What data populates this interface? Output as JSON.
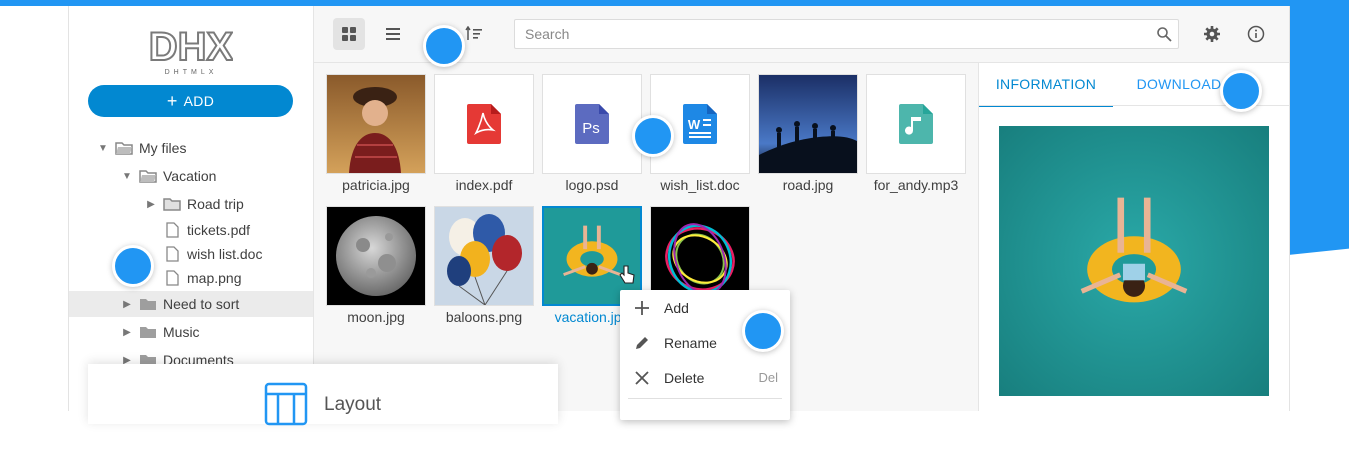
{
  "logo": {
    "main": "DHX",
    "sub": "DHTMLX"
  },
  "sidebar": {
    "add_label": "ADD",
    "tree": [
      {
        "label": "My files",
        "type": "folder-open",
        "expanded": true
      },
      {
        "label": "Vacation",
        "type": "folder-open",
        "expanded": true
      },
      {
        "label": "Road trip",
        "type": "folder",
        "expanded": false
      },
      {
        "label": "tickets.pdf",
        "type": "file"
      },
      {
        "label": "wish list.doc",
        "type": "file"
      },
      {
        "label": "map.png",
        "type": "file"
      },
      {
        "label": "Need to sort",
        "type": "folder-filled",
        "expanded": false,
        "selected": true
      },
      {
        "label": "Music",
        "type": "folder-filled",
        "expanded": false
      },
      {
        "label": "Documents",
        "type": "folder-filled",
        "expanded": false
      }
    ]
  },
  "toolbar": {
    "search_placeholder": "Search",
    "buttons": [
      "grid-view",
      "list-view",
      "sort",
      "settings",
      "info"
    ]
  },
  "files": [
    {
      "name": "patricia.jpg",
      "kind": "photo-person"
    },
    {
      "name": "index.pdf",
      "kind": "pdf",
      "color": "#e53935"
    },
    {
      "name": "logo.psd",
      "kind": "psd",
      "color": "#5c6bc0"
    },
    {
      "name": "wish_list.doc",
      "kind": "doc",
      "color": "#1e88e5"
    },
    {
      "name": "road.jpg",
      "kind": "photo-road"
    },
    {
      "name": "for_andy.mp3",
      "kind": "mp3",
      "color": "#4db6ac"
    },
    {
      "name": "moon.jpg",
      "kind": "photo-moon"
    },
    {
      "name": "baloons.png",
      "kind": "photo-balloons"
    },
    {
      "name": "vacation.jpg",
      "kind": "photo-vacation",
      "selected": true
    },
    {
      "name": "",
      "kind": "photo-swirl"
    }
  ],
  "panel": {
    "tabs": [
      {
        "label": "INFORMATION",
        "active": true
      },
      {
        "label": "DOWNLOAD",
        "active": false
      }
    ]
  },
  "context_menu": [
    {
      "label": "Add",
      "icon": "plus-icon",
      "hotkey": ""
    },
    {
      "label": "Rename",
      "icon": "pencil-icon",
      "hotkey": ""
    },
    {
      "label": "Delete",
      "icon": "close-icon",
      "hotkey": "Del"
    }
  ],
  "overlay_card": {
    "label": "Layout"
  },
  "colors": {
    "accent": "#0288d1",
    "brand_blue": "#2196f3"
  }
}
